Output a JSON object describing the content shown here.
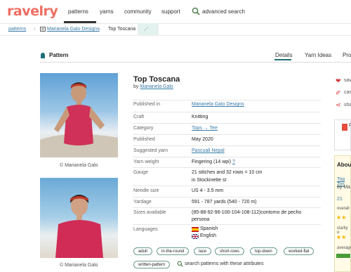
{
  "header": {
    "logo": "ravelry",
    "nav": [
      "patterns",
      "yarns",
      "community",
      "support"
    ],
    "advanced_search": "advanced search",
    "active": "patterns"
  },
  "breadcrumb": {
    "patterns": "patterns",
    "designer": "Marianela Galo Designs",
    "current": "Top Toscana"
  },
  "section": {
    "title": "Pattern",
    "tabs": [
      "Details",
      "Yarn Ideas",
      "Proj"
    ],
    "active_tab": "Details"
  },
  "photos": {
    "credit1": "© Marianela Galo",
    "credit2": "© Marianela Galo"
  },
  "pattern": {
    "title": "Top Toscana",
    "by_prefix": "by",
    "by": "Marianela Galo"
  },
  "attributes": {
    "published_in_label": "Published in",
    "published_in": "Marianela Galo Designs",
    "craft_label": "Craft",
    "craft": "Knitting",
    "category_label": "Category",
    "category": "Tops → Tee",
    "published_label": "Published",
    "published": "May 2020",
    "suggested_yarn_label": "Suggested yarn",
    "suggested_yarn": "Pascuali Nepal",
    "yarn_weight_label": "Yarn weight",
    "yarn_weight": "Fingering (14 wpi)",
    "yarn_weight_help": "?",
    "gauge_label": "Gauge",
    "gauge_line1": "21 stitches and 32 rows = 10 cm",
    "gauge_line2": "in Stockinette st",
    "needle_label": "Needle size",
    "needle": "US 4 - 3.5 mm",
    "yardage_label": "Yardage",
    "yardage": "591 - 787 yards (540 - 720 m)",
    "sizes_label": "Sizes available",
    "sizes_line1": "(85-88-92-96-100-104-108-112)contorno de pecho",
    "sizes_line2": "persona",
    "languages_label": "Languages",
    "languages": [
      "Spanish",
      "English"
    ]
  },
  "tags": [
    "adult",
    "in-the-round",
    "lace",
    "short-rows",
    "top-down",
    "worked-flat",
    "written-pattern"
  ],
  "tags_search": "search patterns with these attributes",
  "sidebar": {
    "save": "sav",
    "cast": "cas",
    "share": "sha",
    "pdf": "P",
    "about_title": "Abou",
    "about_link": "Top Tos",
    "about_by": "by Ma",
    "count": "21",
    "overall": "overall",
    "clarity": "clarity o",
    "average": "average",
    "stars_overall": "★★",
    "stars_clarity": "★★",
    "difficulty_fraction": 0.95
  },
  "colors": {
    "brand": "#ee6e62",
    "link": "#3a7aa8",
    "accent": "#1f6e78"
  }
}
